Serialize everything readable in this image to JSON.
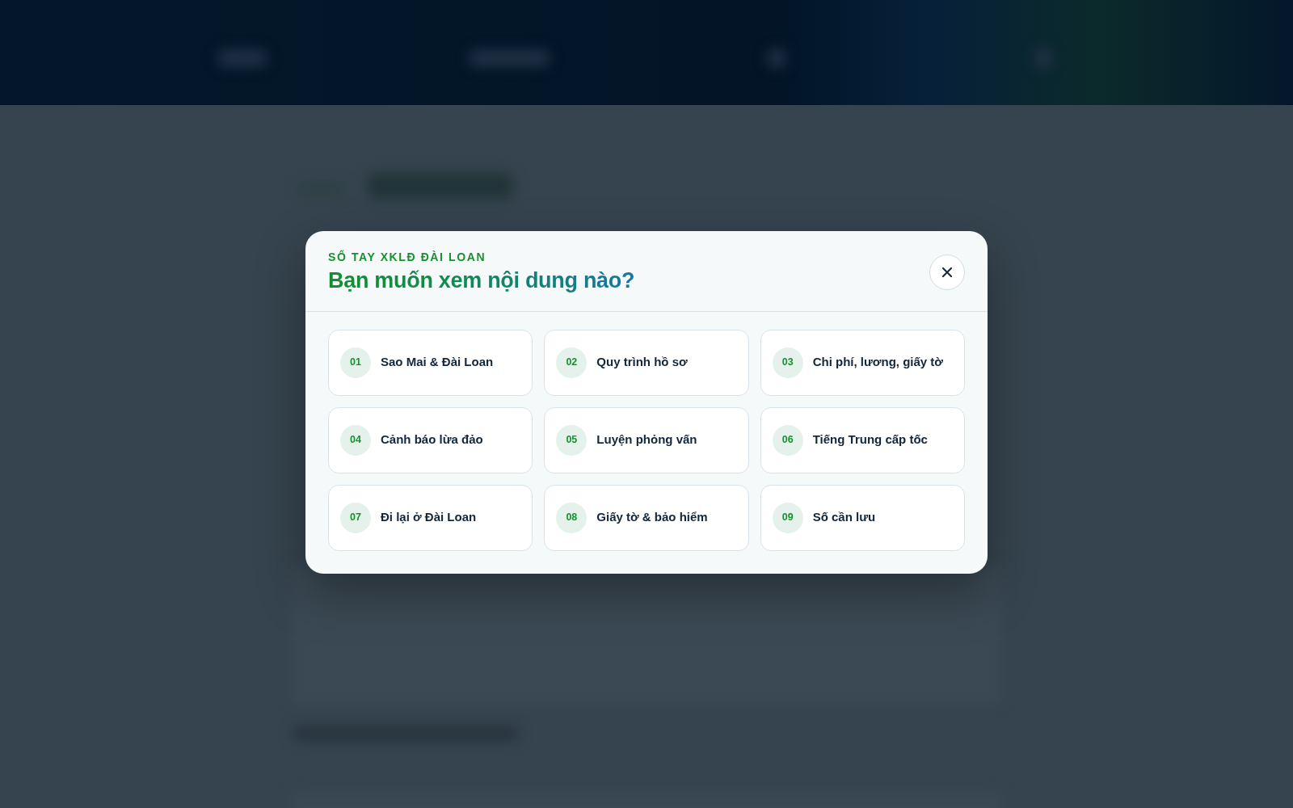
{
  "modal": {
    "eyebrow": "SỔ TAY XKLĐ ĐÀI LOAN",
    "title": "Bạn muốn xem nội dung nào?",
    "items": [
      {
        "number": "01",
        "label": "Sao Mai & Đài Loan"
      },
      {
        "number": "02",
        "label": "Quy trình hồ sơ"
      },
      {
        "number": "03",
        "label": "Chi phí, lương, giấy tờ"
      },
      {
        "number": "04",
        "label": "Cảnh báo lừa đảo"
      },
      {
        "number": "05",
        "label": "Luyện phỏng vấn"
      },
      {
        "number": "06",
        "label": "Tiếng Trung cấp tốc"
      },
      {
        "number": "07",
        "label": "Đi lại ở Đài Loan"
      },
      {
        "number": "08",
        "label": "Giấy tờ & bảo hiểm"
      },
      {
        "number": "09",
        "label": "Số cần lưu"
      }
    ]
  }
}
